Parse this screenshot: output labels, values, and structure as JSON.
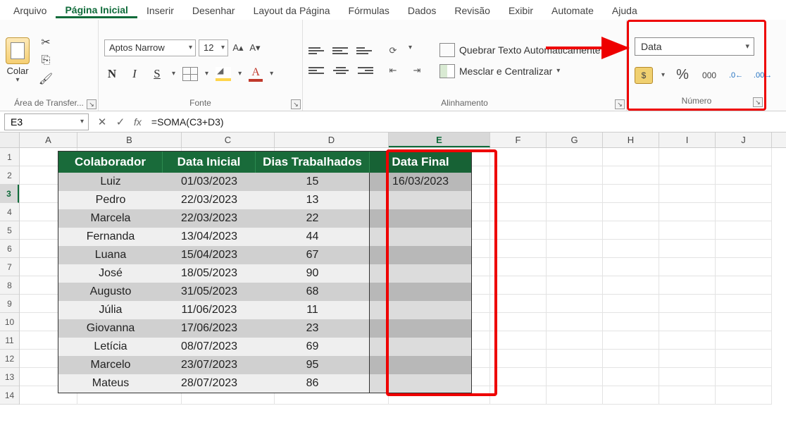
{
  "menu": {
    "tabs": [
      "Arquivo",
      "Página Inicial",
      "Inserir",
      "Desenhar",
      "Layout da Página",
      "Fórmulas",
      "Dados",
      "Revisão",
      "Exibir",
      "Automate",
      "Ajuda"
    ],
    "active_index": 1
  },
  "ribbon": {
    "clipboard": {
      "paste_label": "Colar",
      "group_label": "Área de Transfer..."
    },
    "font": {
      "name": "Aptos Narrow",
      "size": "12",
      "bold": "N",
      "italic": "I",
      "underline": "S",
      "group_label": "Fonte"
    },
    "alignment": {
      "wrap_label": "Quebrar Texto Automaticamente",
      "merge_label": "Mesclar e Centralizar",
      "group_label": "Alinhamento"
    },
    "number": {
      "format": "Data",
      "percent": "%",
      "thousands": "000",
      "group_label": "Número"
    }
  },
  "formula_bar": {
    "cell_ref": "E3",
    "formula": "=SOMA(C3+D3)"
  },
  "columns": [
    "A",
    "B",
    "C",
    "D",
    "E",
    "F",
    "G",
    "H",
    "I",
    "J"
  ],
  "selected_column_index": 4,
  "selected_row_index": 3,
  "row_numbers": [
    "1",
    "2",
    "3",
    "4",
    "5",
    "6",
    "7",
    "8",
    "9",
    "10",
    "11",
    "12",
    "13",
    "14"
  ],
  "table": {
    "headers": [
      "Colaborador",
      "Data Inicial",
      "Dias Trabalhados",
      "Data Final"
    ],
    "rows": [
      {
        "colab": "Luiz",
        "inicio": "01/03/2023",
        "dias": "15",
        "final": "16/03/2023"
      },
      {
        "colab": "Pedro",
        "inicio": "22/03/2023",
        "dias": "13",
        "final": ""
      },
      {
        "colab": "Marcela",
        "inicio": "22/03/2023",
        "dias": "22",
        "final": ""
      },
      {
        "colab": "Fernanda",
        "inicio": "13/04/2023",
        "dias": "44",
        "final": ""
      },
      {
        "colab": "Luana",
        "inicio": "15/04/2023",
        "dias": "67",
        "final": ""
      },
      {
        "colab": "José",
        "inicio": "18/05/2023",
        "dias": "90",
        "final": ""
      },
      {
        "colab": "Augusto",
        "inicio": "31/05/2023",
        "dias": "68",
        "final": ""
      },
      {
        "colab": "Júlia",
        "inicio": "11/06/2023",
        "dias": "11",
        "final": ""
      },
      {
        "colab": "Giovanna",
        "inicio": "17/06/2023",
        "dias": "23",
        "final": ""
      },
      {
        "colab": "Letícia",
        "inicio": "08/07/2023",
        "dias": "69",
        "final": ""
      },
      {
        "colab": "Marcelo",
        "inicio": "23/07/2023",
        "dias": "95",
        "final": ""
      },
      {
        "colab": "Mateus",
        "inicio": "28/07/2023",
        "dias": "86",
        "final": ""
      }
    ]
  }
}
